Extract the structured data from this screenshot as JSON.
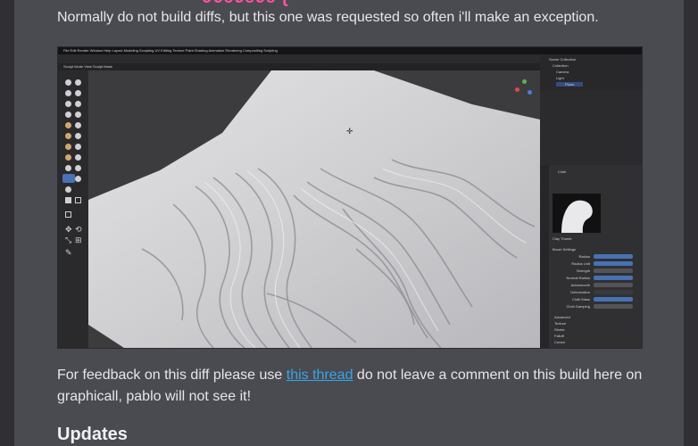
{
  "heading_fragment": "ʋʋƽʋƽʋƽ ɭ",
  "intro_text": "Normally do not build diffs, but this one was requested so often i'll make an exception.",
  "screenshot": {
    "menu": "File  Edit  Render  Window  Help     Layout  Modeling  Sculpting  UV Editing  Texture Paint  Shading  Animation  Rendering  Compositing  Scripting",
    "header_hint": "Sculpt Mode  View  Sculpt  Mask",
    "right_title": "Scene Collection",
    "outliner_items": [
      "Collection",
      "Camera",
      "Light",
      "Plane"
    ],
    "props_header": "Cloth",
    "brush_label": "Clay Thumb",
    "settings_label": "Brush Settings",
    "settings_rows": [
      "Radius",
      "Radius Unit",
      "Strength",
      "Normal Radius",
      "Autosmooth",
      "Deformation",
      "Cloth Mass",
      "Cloth Damping"
    ],
    "collapsed_sections": [
      "Advanced",
      "Texture",
      "Stroke",
      "Falloff",
      "Cursor"
    ],
    "colors": {
      "viewport": "#3c3c3f",
      "panel": "#2e2e31",
      "accent": "#4772b3"
    }
  },
  "feedback": {
    "before": "For feedback on this diff please use ",
    "link": "this thread",
    "after": " do not leave a comment on this build here on graphicall, pablo will not see it!"
  },
  "updates_heading": "Updates"
}
